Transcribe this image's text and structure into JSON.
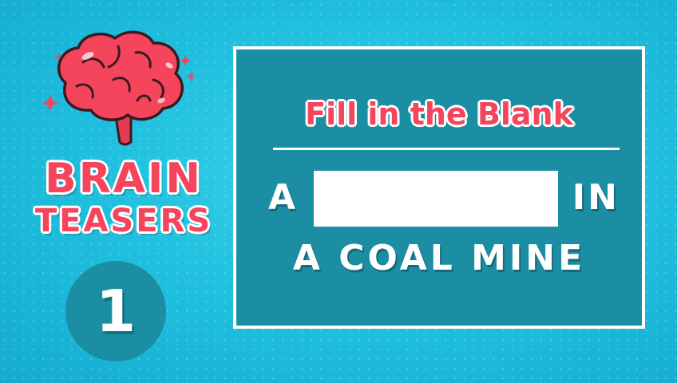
{
  "logo": {
    "icon": "brain-icon",
    "title_line1": "BRAIN",
    "title_line2": "TEASERS"
  },
  "episode": {
    "number": "1"
  },
  "puzzle": {
    "heading": "Fill in the Blank",
    "line1_before": "A",
    "line1_after": "IN",
    "line2": "A COAL MINE"
  },
  "colors": {
    "background": "#22c2e0",
    "panel": "#1b8ea3",
    "accent": "#f4455c",
    "text": "#ffffff"
  }
}
